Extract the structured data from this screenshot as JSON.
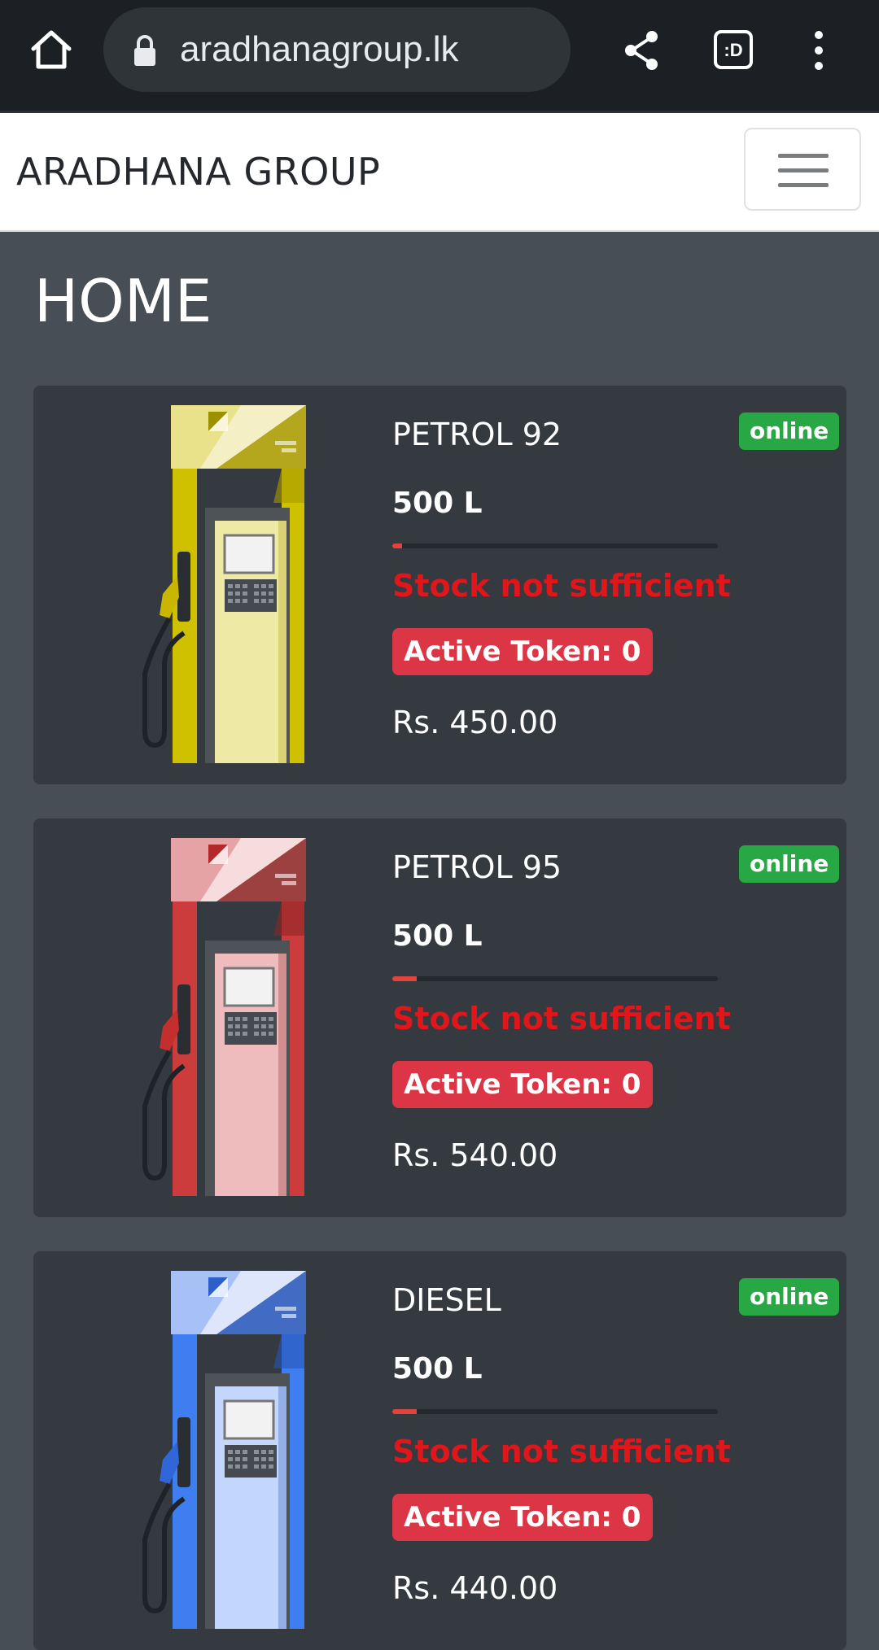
{
  "browser": {
    "url": "aradhanagroup.lk",
    "tab_switcher_label": ":D"
  },
  "navbar": {
    "brand": "ARADHANA GROUP"
  },
  "page": {
    "title": "HOME"
  },
  "colors": {
    "online": "#28a745",
    "danger": "#dc3545",
    "warning_text": "#e0161b",
    "card_bg": "#343a40"
  },
  "fuels": [
    {
      "name": "PETROL 92",
      "status": "online",
      "stock": "500 L",
      "stock_fill_fraction": 0.03,
      "warning": "Stock not sufficient",
      "token": "Active Token: 0",
      "price": "Rs. 450.00",
      "pump_color": "yellow"
    },
    {
      "name": "PETROL 95",
      "status": "online",
      "stock": "500 L",
      "stock_fill_fraction": 0.075,
      "warning": "Stock not sufficient",
      "token": "Active Token: 0",
      "price": "Rs. 540.00",
      "pump_color": "red"
    },
    {
      "name": "DIESEL",
      "status": "online",
      "stock": "500 L",
      "stock_fill_fraction": 0.075,
      "warning": "Stock not sufficient",
      "token": "Active Token: 0",
      "price": "Rs. 440.00",
      "pump_color": "blue"
    }
  ]
}
